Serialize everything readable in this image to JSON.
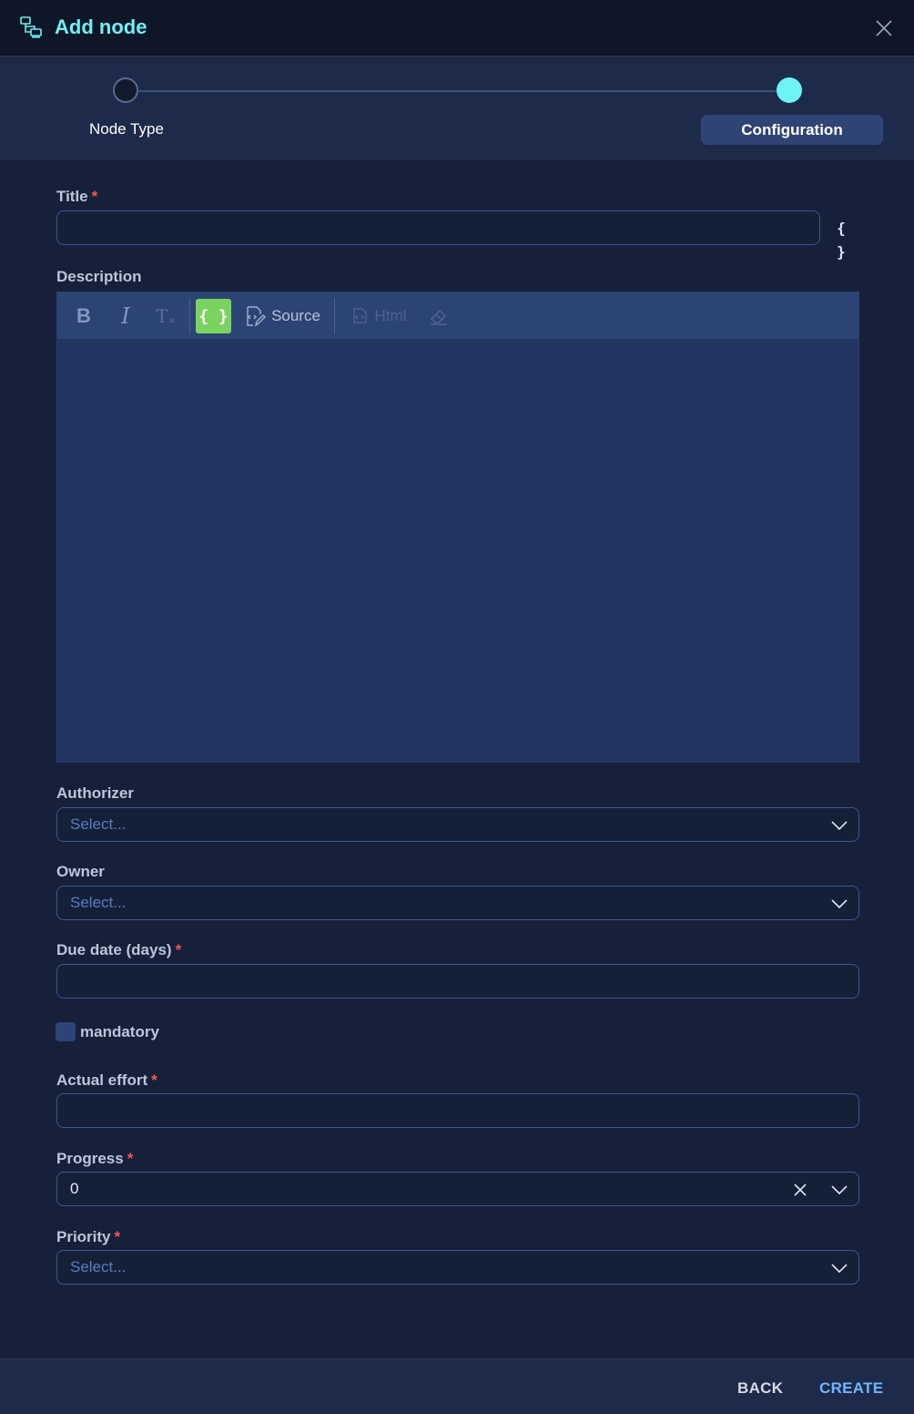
{
  "header": {
    "title": "Add node",
    "icon": "node-tree-icon"
  },
  "stepper": {
    "steps": [
      {
        "label": "Node Type",
        "active": false
      },
      {
        "label": "Configuration",
        "active": true
      }
    ],
    "accent": "#6ef3f5"
  },
  "form": {
    "title": {
      "label": "Title",
      "required": "*",
      "value": "",
      "variable_button": "{ }"
    },
    "description": {
      "label": "Description",
      "toolbar": {
        "bold": "B",
        "italic": "I",
        "clear_format": "T",
        "variables": "{ }",
        "source": "Source",
        "html": "Html"
      },
      "value": ""
    },
    "authorizer": {
      "label": "Authorizer",
      "placeholder": "Select..."
    },
    "owner": {
      "label": "Owner",
      "placeholder": "Select..."
    },
    "due_date": {
      "label": "Due date (days)",
      "required": "*",
      "value": ""
    },
    "mandatory": {
      "label": "mandatory",
      "checked": false
    },
    "actual_effort": {
      "label": "Actual effort",
      "required": "*",
      "value": ""
    },
    "progress": {
      "label": "Progress",
      "required": "*",
      "value": "0"
    },
    "priority": {
      "label": "Priority",
      "required": "*",
      "placeholder": "Select..."
    }
  },
  "footer": {
    "back_label": "BACK",
    "create_label": "CREATE"
  },
  "colors": {
    "header_bg": "#0f1628",
    "body_bg": "#16203a",
    "title_accent": "#6ff0f2",
    "create_accent": "#6fb7ff",
    "required_star": "#ff5252",
    "variable_button_bg": "#7bd35f"
  }
}
